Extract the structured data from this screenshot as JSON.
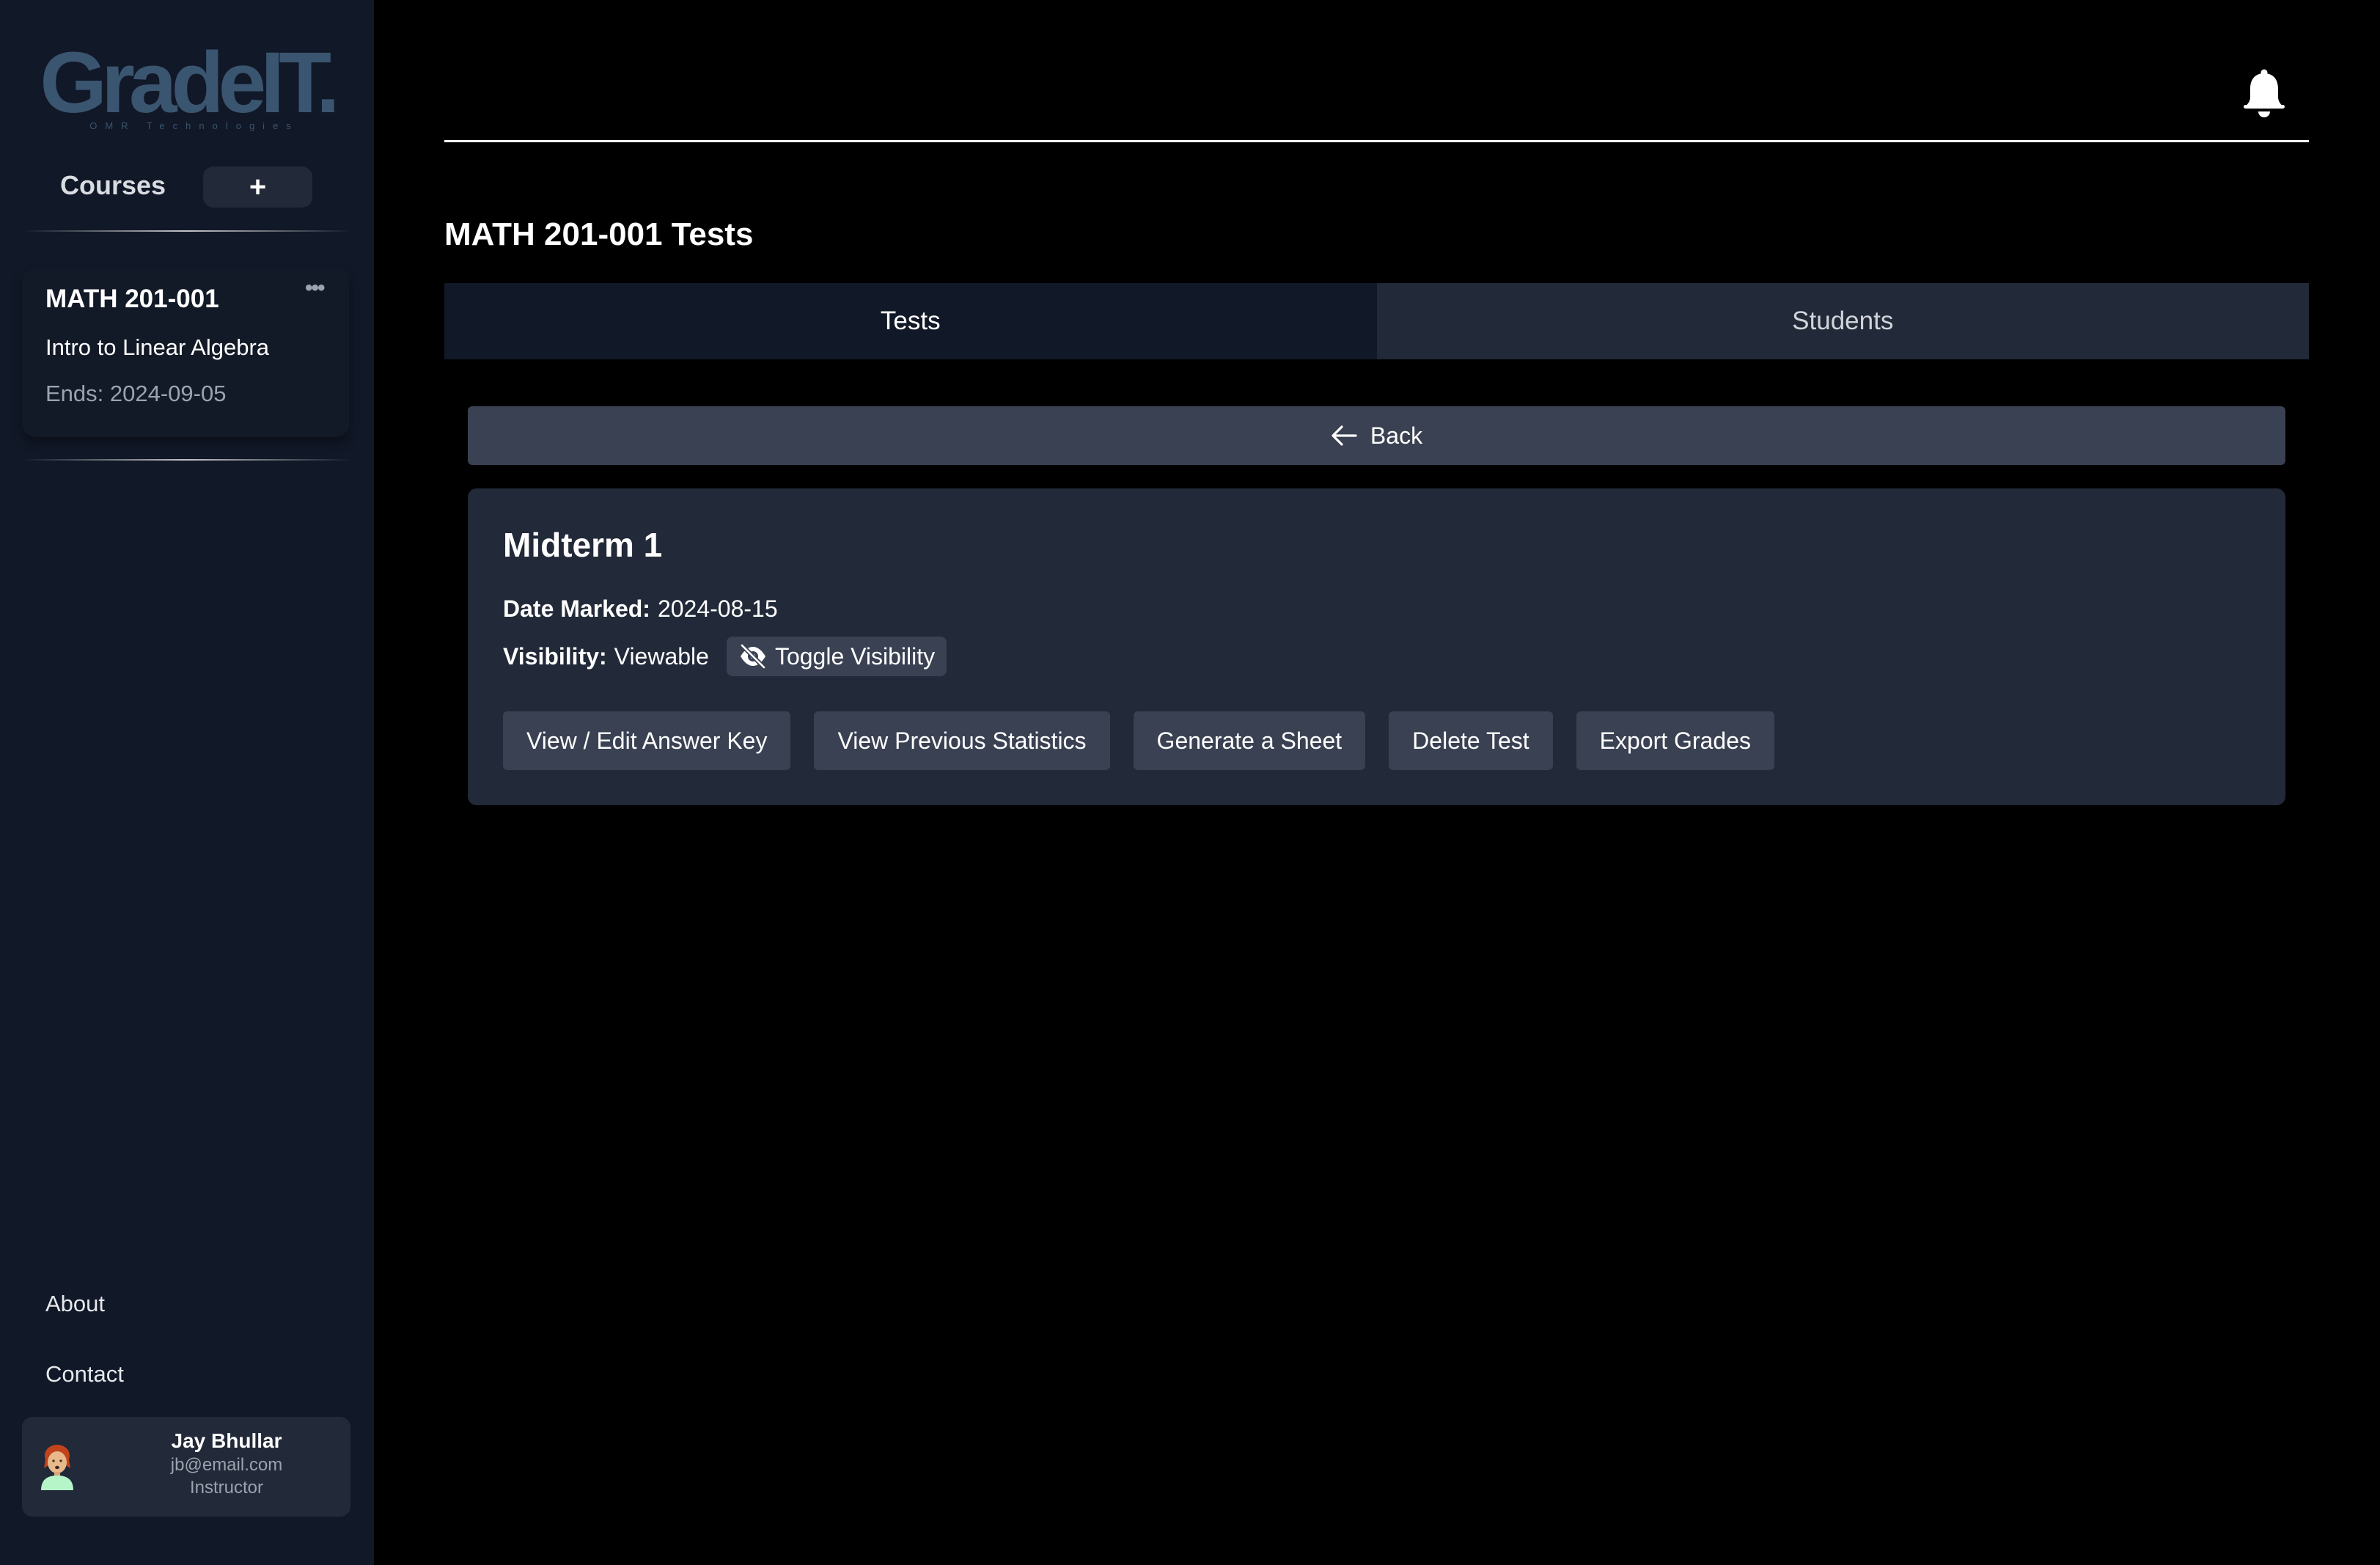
{
  "app": {
    "logo_text": "GradeIT.",
    "logo_tagline": "OMR Technologies"
  },
  "sidebar": {
    "courses_label": "Courses",
    "add_course_label": "+",
    "courses": [
      {
        "code": "MATH 201-001",
        "name": "Intro to Linear Algebra",
        "ends": "Ends: 2024-09-05",
        "menu_icon": "more-horizontal-icon"
      }
    ],
    "links": [
      {
        "label": "About"
      },
      {
        "label": "Contact"
      }
    ],
    "user": {
      "name": "Jay Bhullar",
      "email": "jb@email.com",
      "role": "Instructor",
      "avatar_icon": "user-avatar-icon"
    }
  },
  "header": {
    "notification_icon": "bell-icon"
  },
  "main": {
    "title": "MATH 201-001 Tests",
    "tabs": [
      {
        "label": "Tests",
        "active": true
      },
      {
        "label": "Students",
        "active": false
      }
    ],
    "back_label": "Back",
    "test": {
      "name": "Midterm 1",
      "date_marked_label": "Date Marked:",
      "date_marked": "2024-08-15",
      "visibility_label": "Visibility:",
      "visibility": "Viewable",
      "toggle_label": "Toggle Visibility",
      "actions": [
        {
          "label": "View / Edit Answer Key"
        },
        {
          "label": "View Previous Statistics"
        },
        {
          "label": "Generate a Sheet"
        },
        {
          "label": "Delete Test"
        },
        {
          "label": "Export Grades"
        }
      ]
    }
  },
  "colors": {
    "sidebar_bg": "#111827",
    "card_bg": "#222938",
    "button_bg": "#394152",
    "logo": "#3a5570",
    "muted_text": "#9ca3af"
  }
}
